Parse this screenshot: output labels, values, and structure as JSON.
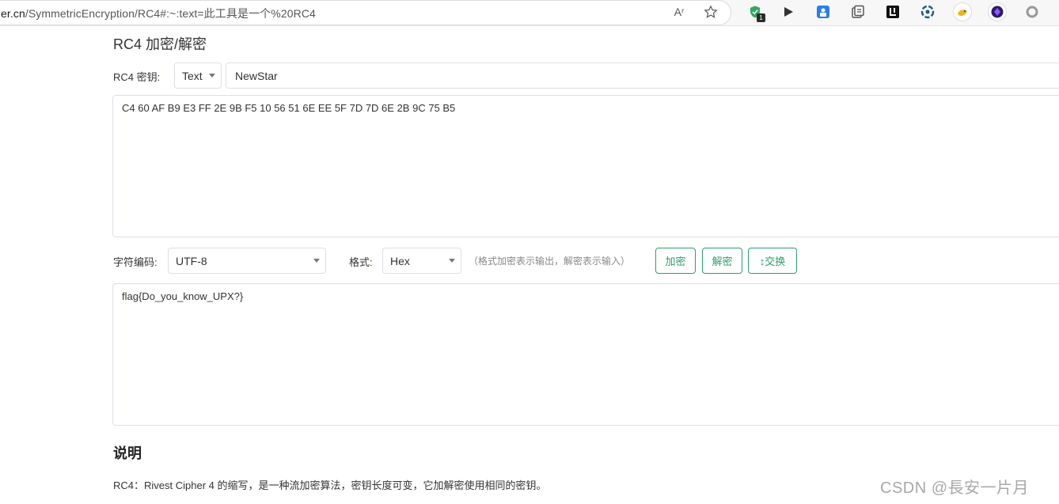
{
  "browser": {
    "url_host": "er.cn",
    "url_path": "/SymmetricEncryption/RC4#:~:text=此工具是一个%20RC4",
    "read_aloud_icon": "Aʳ",
    "extension_badge": "1"
  },
  "page": {
    "title": "RC4 加密/解密",
    "key_label": "RC4 密钥:",
    "key_type": "Text",
    "key_value": "NewStar",
    "input_text": "C4 60 AF B9 E3 FF 2E 9B F5 10 56 51 6E EE 5F 7D 7D 6E 2B 9C 75 B5",
    "charset_label": "字符编码:",
    "charset_value": "UTF-8",
    "format_label": "格式:",
    "format_value": "Hex",
    "format_hint": "（格式加密表示输出，解密表示输入）",
    "encrypt_button": "加密",
    "decrypt_button": "解密",
    "swap_button": "↕交换",
    "output_text": "flag{Do_you_know_UPX?}",
    "section_title": "说明",
    "description": "RC4：Rivest Cipher 4 的缩写，是一种流加密算法，密钥长度可变，它加解密使用相同的密钥。"
  },
  "watermark": "CSDN @長安一片月",
  "colors": {
    "accent": "#2e9e6b",
    "border": "#dcdfe6"
  }
}
